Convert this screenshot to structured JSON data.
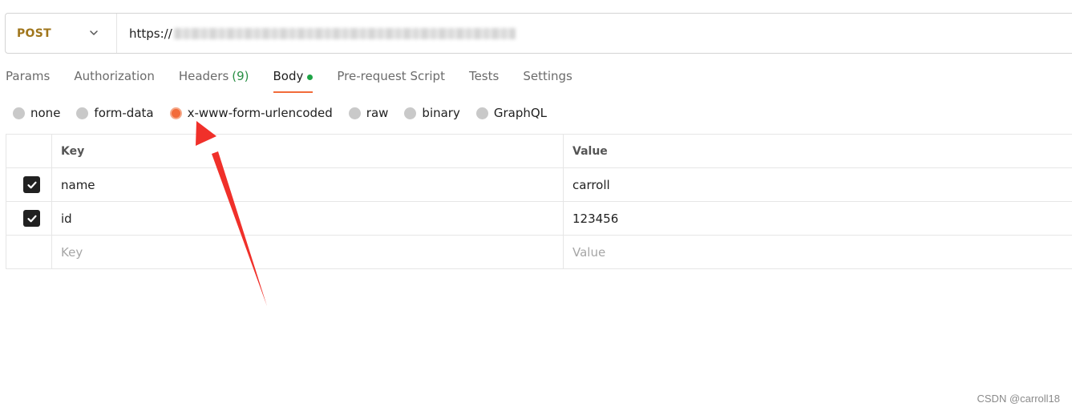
{
  "request": {
    "method": "POST",
    "url_visible": "https://"
  },
  "tabs": [
    {
      "label": "Params"
    },
    {
      "label": "Authorization"
    },
    {
      "label": "Headers",
      "count": "(9)"
    },
    {
      "label": "Body",
      "active": true
    },
    {
      "label": "Pre-request Script"
    },
    {
      "label": "Tests"
    },
    {
      "label": "Settings"
    }
  ],
  "body_types": [
    {
      "label": "none"
    },
    {
      "label": "form-data"
    },
    {
      "label": "x-www-form-urlencoded",
      "selected": true
    },
    {
      "label": "raw"
    },
    {
      "label": "binary"
    },
    {
      "label": "GraphQL"
    }
  ],
  "table": {
    "headers": {
      "key": "Key",
      "value": "Value"
    },
    "rows": [
      {
        "checked": true,
        "key": "name",
        "value": "carroll"
      },
      {
        "checked": true,
        "key": "id",
        "value": "123456"
      }
    ],
    "placeholder": {
      "key": "Key",
      "value": "Value"
    }
  },
  "colors": {
    "accent": "#f26b3a",
    "method": "#a0761c",
    "body_dot": "#1ea446",
    "annotation_arrow": "#f0302a"
  },
  "icons": {
    "method_dropdown": "chevron-down-icon",
    "row_checkbox": "checkbox-checked-icon",
    "annotation": "red-arrow-annotation"
  },
  "watermark": "CSDN @carroll18"
}
